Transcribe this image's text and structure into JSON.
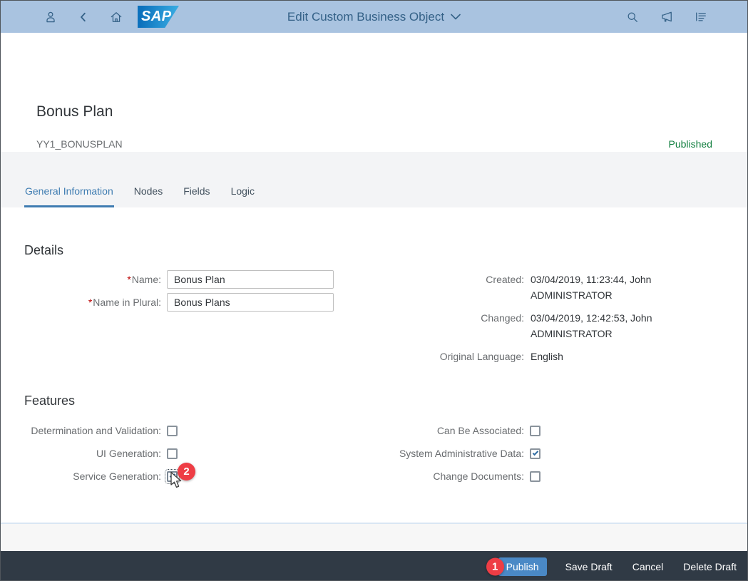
{
  "shell": {
    "logo": "SAP",
    "title": "Edit Custom Business Object",
    "icons": [
      "person",
      "back",
      "home",
      "search",
      "megaphone",
      "menu-list"
    ]
  },
  "page": {
    "title": "Bonus Plan",
    "subtitle": "YY1_BONUSPLAN",
    "status": "Published"
  },
  "tabs": [
    {
      "label": "General Information",
      "active": true
    },
    {
      "label": "Nodes",
      "active": false
    },
    {
      "label": "Fields",
      "active": false
    },
    {
      "label": "Logic",
      "active": false
    }
  ],
  "details": {
    "heading": "Details",
    "required_marker": "*",
    "fields": [
      {
        "label": "Name:",
        "value": "Bonus Plan"
      },
      {
        "label": "Name in Plural:",
        "value": "Bonus Plans"
      }
    ],
    "info": [
      {
        "label": "Created:",
        "line1": "03/04/2019, 11:23:44, John",
        "line2": "ADMINISTRATOR"
      },
      {
        "label": "Changed:",
        "line1": "03/04/2019, 12:42:53, John",
        "line2": "ADMINISTRATOR"
      },
      {
        "label": "Original Language:",
        "line1": "English",
        "line2": ""
      }
    ]
  },
  "features": {
    "heading": "Features",
    "left": [
      {
        "label": "Determination and Validation:",
        "checked": false,
        "focused": false
      },
      {
        "label": "UI Generation:",
        "checked": false,
        "focused": false
      },
      {
        "label": "Service Generation:",
        "checked": true,
        "focused": true
      }
    ],
    "right": [
      {
        "label": "Can Be Associated:",
        "checked": false,
        "focused": false
      },
      {
        "label": "System Administrative Data:",
        "checked": true,
        "focused": false
      },
      {
        "label": "Change Documents:",
        "checked": false,
        "focused": false
      }
    ]
  },
  "annotations": {
    "step1": "1",
    "step2": "2"
  },
  "footer": {
    "publish": "Publish",
    "save_draft": "Save Draft",
    "cancel": "Cancel",
    "delete_draft": "Delete Draft"
  },
  "colors": {
    "shell_bg": "#a9c3e0",
    "shell_icon": "#346187",
    "status_green": "#107e3e",
    "tab_active": "#3e7cb1",
    "footer_bg": "#303a45",
    "publish_blue": "#4a89c6",
    "badge_red": "#ee3d45",
    "check_blue": "#2f6ca3"
  }
}
